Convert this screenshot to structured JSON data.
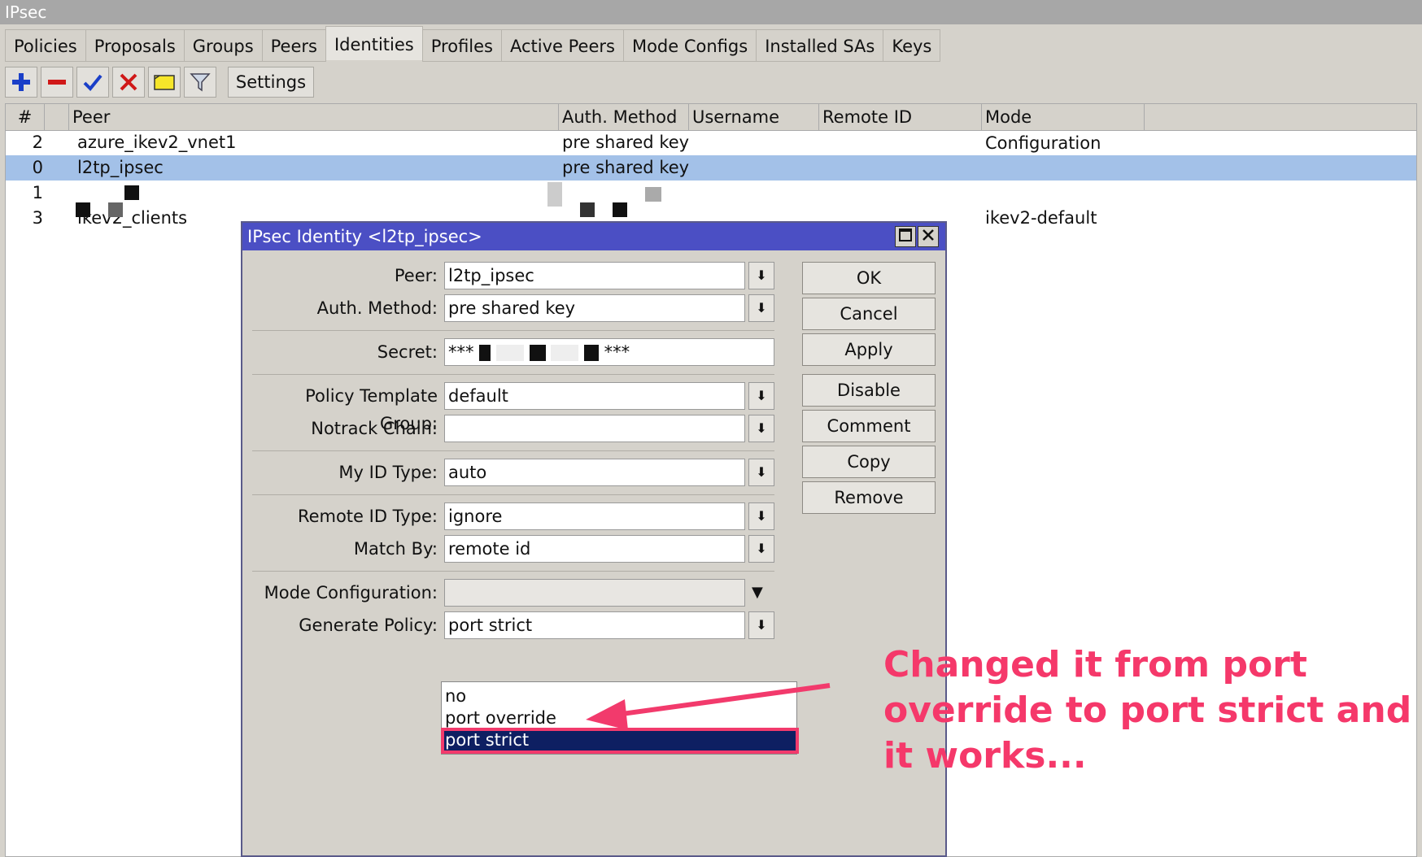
{
  "window": {
    "title": "IPsec"
  },
  "tabs": [
    "Policies",
    "Proposals",
    "Groups",
    "Peers",
    "Identities",
    "Profiles",
    "Active Peers",
    "Mode Configs",
    "Installed SAs",
    "Keys"
  ],
  "active_tab": "Identities",
  "toolbar": {
    "settings_label": "Settings"
  },
  "table": {
    "columns": [
      "#",
      "Peer",
      "Auth. Method",
      "Username",
      "Remote ID",
      "Mode Configuration"
    ],
    "rows": [
      {
        "num": "2",
        "peer": "azure_ikev2_vnet1",
        "auth": "pre shared key",
        "mode": ""
      },
      {
        "num": "0",
        "peer": "l2tp_ipsec",
        "auth": "pre shared key",
        "mode": ""
      },
      {
        "num": "1",
        "peer": "",
        "auth": "",
        "mode": ""
      },
      {
        "num": "3",
        "peer": "ikev2_clients",
        "auth": "",
        "mode": "ikev2-default"
      }
    ]
  },
  "dialog": {
    "title": "IPsec Identity <l2tp_ipsec>",
    "fields": {
      "peer": {
        "label": "Peer:",
        "value": "l2tp_ipsec"
      },
      "auth_method": {
        "label": "Auth. Method:",
        "value": "pre shared key"
      },
      "secret": {
        "label": "Secret:",
        "value": "***"
      },
      "secret_end": {
        "value": "***"
      },
      "policy_template_group": {
        "label": "Policy Template Group:",
        "value": "default"
      },
      "notrack_chain": {
        "label": "Notrack Chain:",
        "value": ""
      },
      "my_id_type": {
        "label": "My ID Type:",
        "value": "auto"
      },
      "remote_id_type": {
        "label": "Remote ID Type:",
        "value": "ignore"
      },
      "match_by": {
        "label": "Match By:",
        "value": "remote id"
      },
      "mode_configuration": {
        "label": "Mode Configuration:",
        "value": ""
      },
      "generate_policy": {
        "label": "Generate Policy:",
        "value": "port strict"
      }
    },
    "buttons": [
      "OK",
      "Cancel",
      "Apply",
      "Disable",
      "Comment",
      "Copy",
      "Remove"
    ]
  },
  "dropdown": {
    "options": [
      "no",
      "port override",
      "port strict"
    ],
    "selected": "port strict"
  },
  "annotation": {
    "text": "Changed it from port override to port strict and it works...",
    "color": "#f5386a"
  }
}
